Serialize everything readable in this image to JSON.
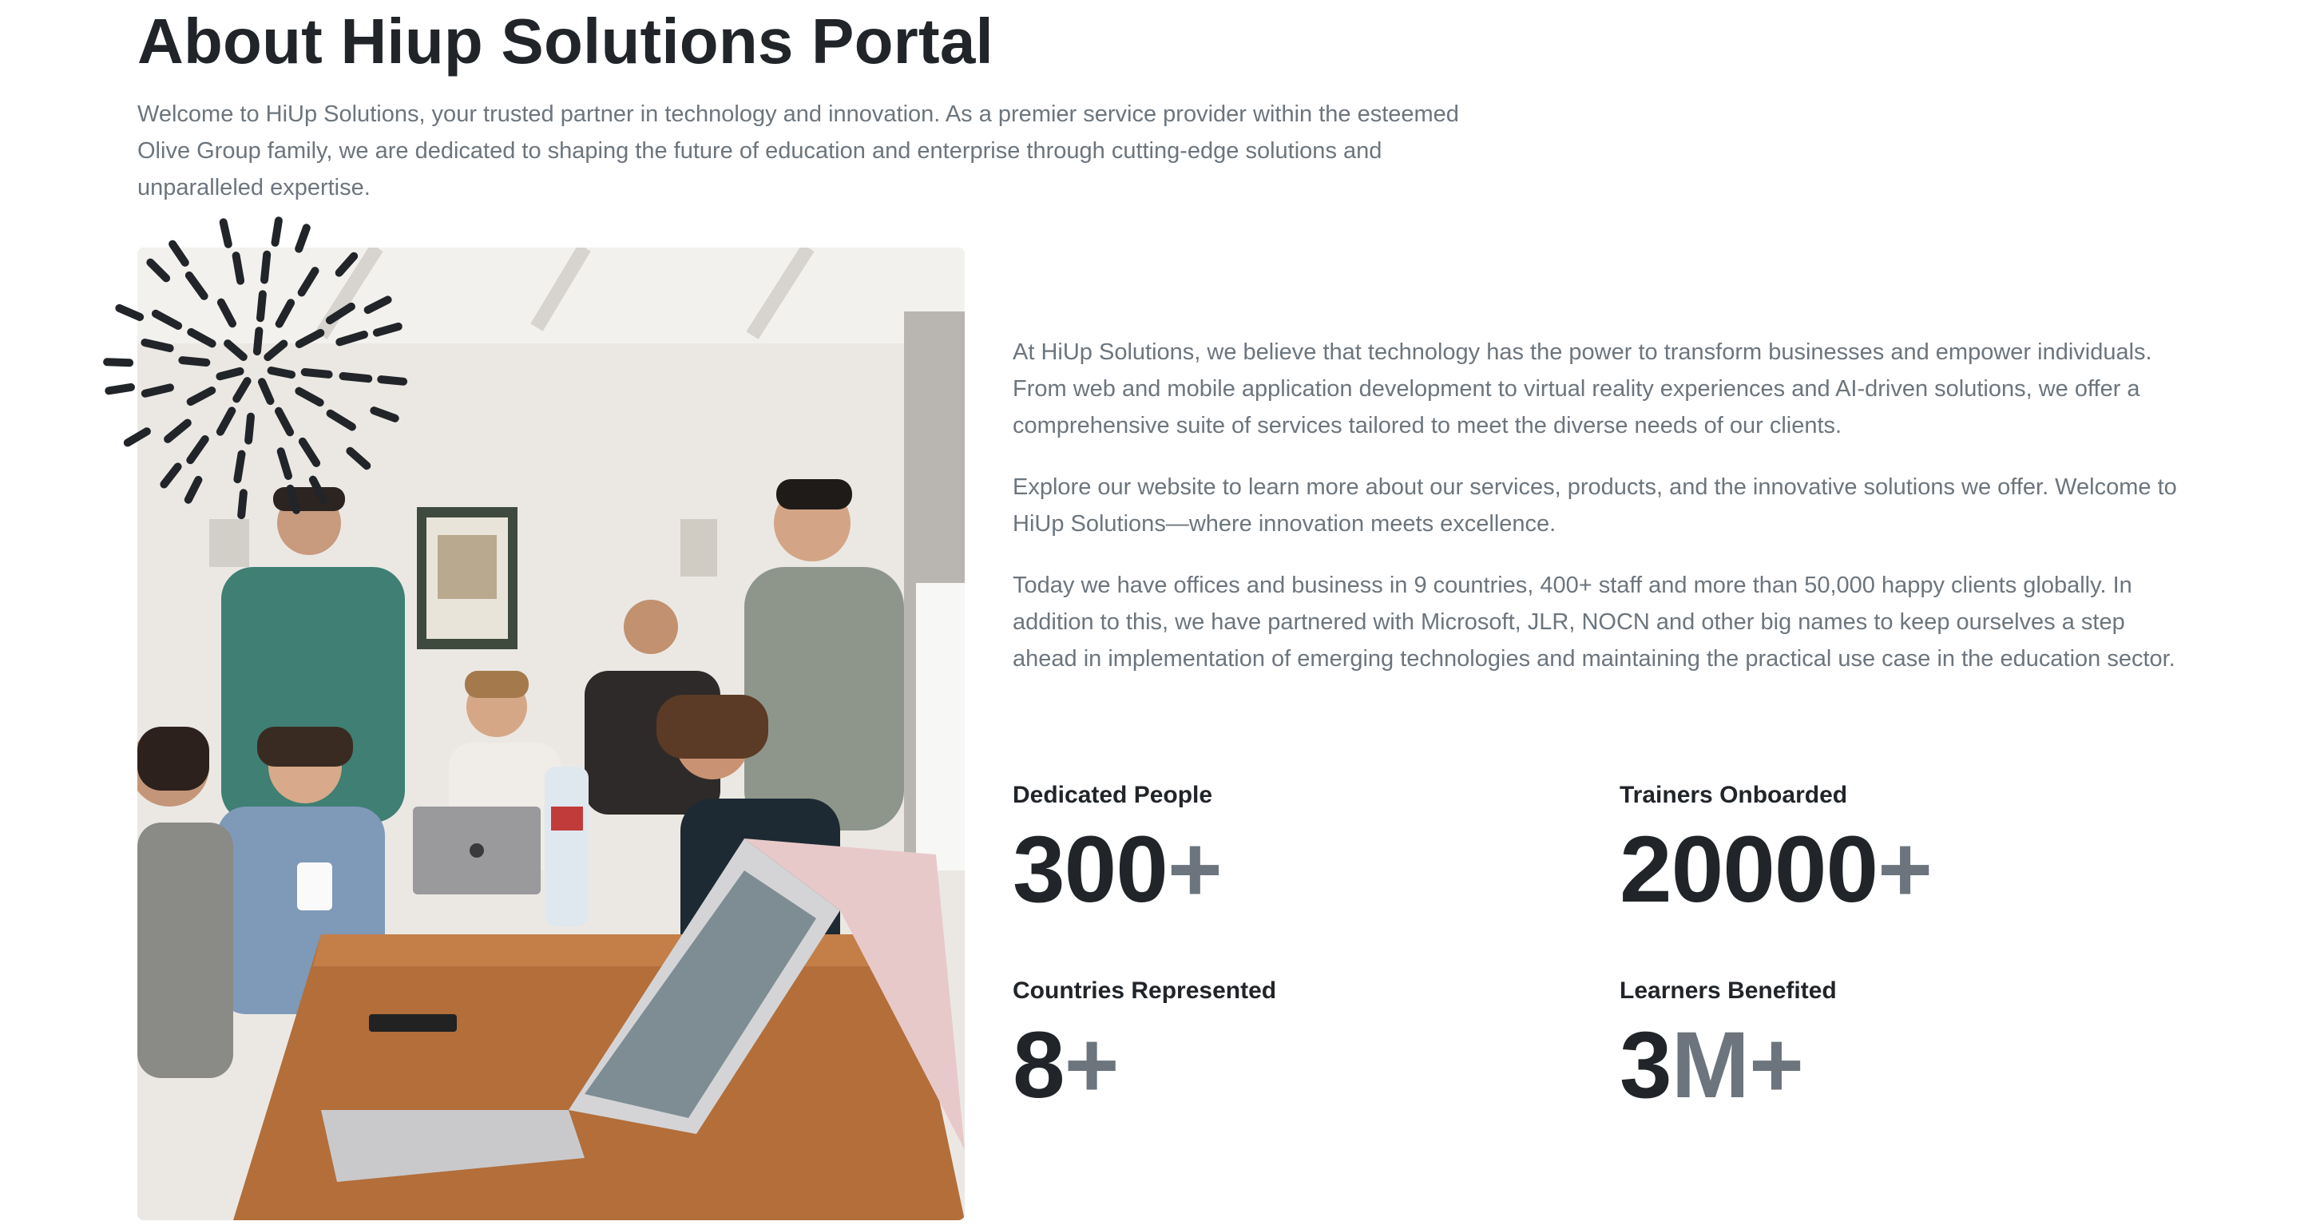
{
  "header": {
    "title": "About Hiup Solutions Portal",
    "intro": "Welcome to HiUp Solutions, your trusted partner in technology and innovation. As a premier service provider within the esteemed Olive Group family, we are dedicated to shaping the future of education and enterprise through cutting-edge solutions and unparalleled expertise."
  },
  "about": {
    "paragraphs": [
      "At HiUp Solutions, we believe that technology has the power to transform businesses and empower individuals. From web and mobile application development to virtual reality experiences and AI-driven solutions, we offer a comprehensive suite of services tailored to meet the diverse needs of our clients.",
      "Explore our website to learn more about our services, products, and the innovative solutions we offer. Welcome to HiUp Solutions—where innovation meets excellence.",
      "Today we have offices and business in 9 countries, 400+ staff and more than 50,000 happy clients globally. In addition to this, we have partnered with Microsoft, JLR, NOCN and other big names to keep ourselves a step ahead in implementation of emerging technologies and maintaining the practical use case in the education sector."
    ]
  },
  "stats": [
    {
      "label": "Dedicated People",
      "value": "300",
      "suffix": "+"
    },
    {
      "label": "Trainers Onboarded",
      "value": "20000",
      "suffix": "+"
    },
    {
      "label": "Countries Represented",
      "value": "8",
      "suffix": "+"
    },
    {
      "label": "Learners Benefited",
      "value": "3",
      "value_dim": "M",
      "suffix": "+"
    }
  ],
  "colors": {
    "heading": "#212529",
    "body_text": "#6c757d",
    "accent_dim": "#6c757d",
    "burst": "#212529"
  },
  "icons": {
    "decoration": "burst-doodle-icon"
  }
}
